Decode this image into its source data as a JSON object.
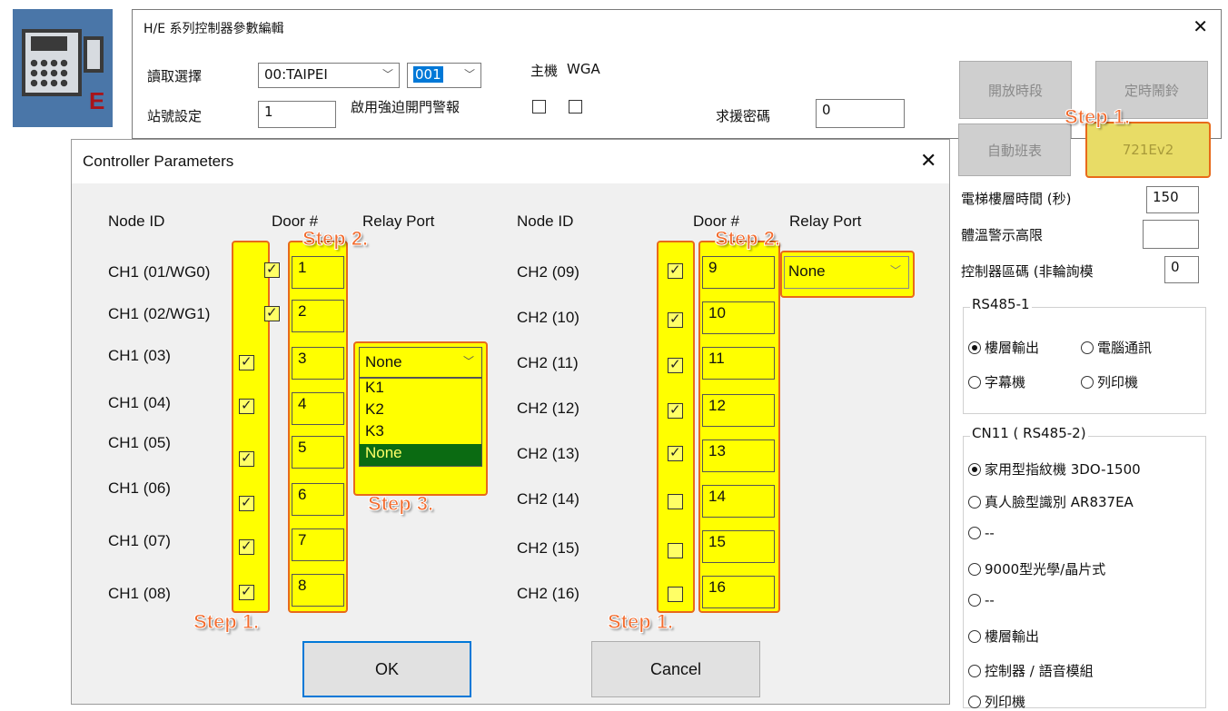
{
  "app_icon": {
    "letter": "E"
  },
  "bg_window": {
    "title": "H/E 系列控制器參數編輯",
    "read_select_label": "讀取選擇",
    "site_select": "00:TAIPEI",
    "node_select": "001",
    "host_label": "主機",
    "wga_label": "WGA",
    "station_label": "站號設定",
    "station_value": "1",
    "force_alarm_label": "啟用強迫開門警報",
    "help_pwd_label": "求援密碼",
    "help_pwd_value": "0",
    "open_period_button": "開放時段",
    "timer_bell_button": "定時鬧鈴",
    "auto_schedule_button": "自動班表",
    "model_button": "721Ev2"
  },
  "right_panel": {
    "elevator_time_label": "電梯樓層時間 (秒)",
    "elevator_time_value": "150",
    "temp_label": "體溫警示高限",
    "temp_value": "",
    "area_code_label": "控制器區碼 (非輪詢模",
    "area_code_value": "0",
    "rs485_1": {
      "title": "RS485-1",
      "options": [
        "樓層輸出",
        "電腦通訊",
        "字幕機",
        "列印機"
      ],
      "selected": "樓層輸出"
    },
    "cn11": {
      "title": "CN11 ( RS485-2)",
      "options": [
        "家用型指紋機 3DO-1500",
        "真人臉型識別 AR837EA",
        "--",
        "9000型光學/晶片式",
        "--",
        "樓層輸出",
        "控制器 / 語音模組",
        "列印機"
      ],
      "selected": "家用型指紋機 3DO-1500"
    }
  },
  "dialog": {
    "title": "Controller Parameters",
    "left_headers": {
      "node": "Node ID",
      "door": "Door #",
      "relay": "Relay Port"
    },
    "right_headers": {
      "node": "Node ID",
      "door": "Door #",
      "relay": "Relay Port"
    },
    "left_rows": [
      {
        "node": "CH1 (01/WG0)",
        "checked": true,
        "door": "1"
      },
      {
        "node": "CH1 (02/WG1)",
        "checked": true,
        "door": "2"
      },
      {
        "node": "CH1  (03)",
        "checked": true,
        "door": "3"
      },
      {
        "node": "CH1  (04)",
        "checked": true,
        "door": "4"
      },
      {
        "node": "CH1  (05)",
        "checked": true,
        "door": "5"
      },
      {
        "node": "CH1  (06)",
        "checked": true,
        "door": "6"
      },
      {
        "node": "CH1  (07)",
        "checked": true,
        "door": "7"
      },
      {
        "node": "CH1  (08)",
        "checked": true,
        "door": "8"
      }
    ],
    "right_rows": [
      {
        "node": "CH2  (09)",
        "checked": true,
        "door": "9"
      },
      {
        "node": "CH2  (10)",
        "checked": true,
        "door": "10"
      },
      {
        "node": "CH2  (11)",
        "checked": true,
        "door": "11"
      },
      {
        "node": "CH2  (12)",
        "checked": true,
        "door": "12"
      },
      {
        "node": "CH2 (13)",
        "checked": true,
        "door": "13"
      },
      {
        "node": "CH2  (14)",
        "checked": false,
        "door": "14"
      },
      {
        "node": "CH2  (15)",
        "checked": false,
        "door": "15"
      },
      {
        "node": "CH2  (16)",
        "checked": false,
        "door": "16"
      }
    ],
    "relay_right_value": "None",
    "relay_dropdown": {
      "value": "None",
      "options": [
        "K1",
        "K2",
        "K3",
        "None"
      ],
      "highlighted": "None"
    },
    "ok_button": "OK",
    "cancel_button": "Cancel"
  },
  "annotations": {
    "step1": "Step 1.",
    "step2": "Step 2.",
    "step3": "Step 3.",
    "highlight_color": "#ffff00",
    "outline_color": "#e86a1a",
    "step_color": "#f26b2e"
  }
}
